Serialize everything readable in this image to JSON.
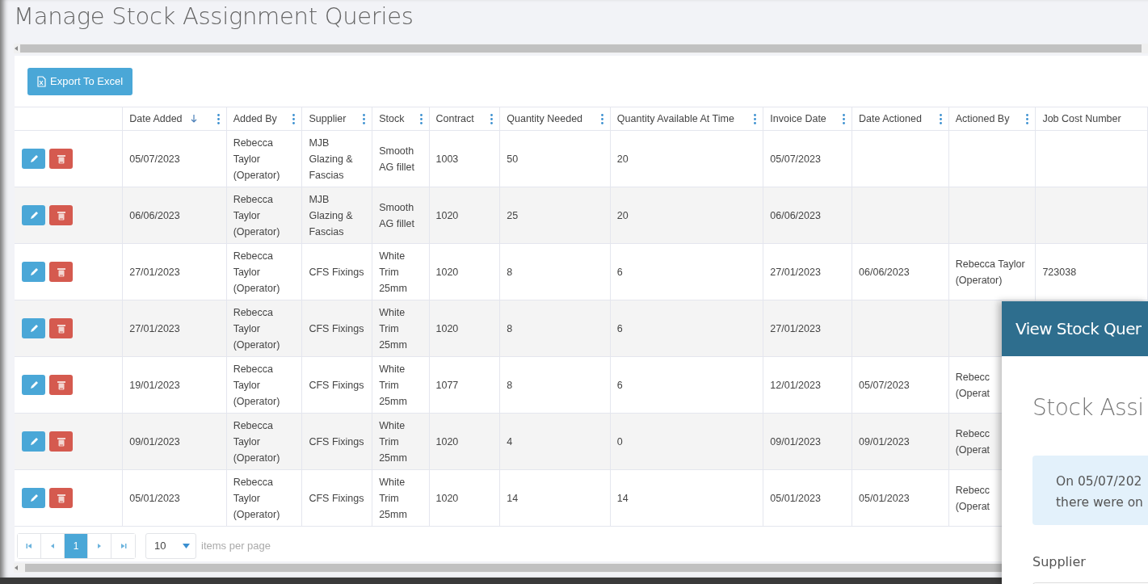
{
  "page": {
    "title": "Manage Stock Assignment Queries"
  },
  "toolbar": {
    "export_button": "Export To Excel"
  },
  "table": {
    "columns": [
      {
        "label": "Date Added",
        "menu": true,
        "sorted": true
      },
      {
        "label": "Added By",
        "menu": true,
        "sorted": false
      },
      {
        "label": "Supplier",
        "menu": true,
        "sorted": false
      },
      {
        "label": "Stock",
        "menu": true,
        "sorted": false
      },
      {
        "label": "Contract",
        "menu": true,
        "sorted": false
      },
      {
        "label": "Quantity Needed",
        "menu": true,
        "sorted": false
      },
      {
        "label": "Quantity Available At Time",
        "menu": true,
        "sorted": false
      },
      {
        "label": "Invoice Date",
        "menu": true,
        "sorted": false
      },
      {
        "label": "Date Actioned",
        "menu": true,
        "sorted": false
      },
      {
        "label": "Actioned By",
        "menu": true,
        "sorted": false
      },
      {
        "label": "Job Cost Number",
        "menu": false,
        "sorted": false
      }
    ],
    "rows": [
      {
        "cells": [
          "05/07/2023",
          "Rebecca Taylor (Operator)",
          "MJB Glazing & Fascias",
          "Smooth AG fillet",
          "1003",
          "50",
          "20",
          "05/07/2023",
          "",
          "",
          ""
        ]
      },
      {
        "cells": [
          "06/06/2023",
          "Rebecca Taylor (Operator)",
          "MJB Glazing & Fascias",
          "Smooth AG fillet",
          "1020",
          "25",
          "20",
          "06/06/2023",
          "",
          "",
          ""
        ]
      },
      {
        "cells": [
          "27/01/2023",
          "Rebecca Taylor (Operator)",
          "CFS Fixings",
          "White Trim 25mm",
          "1020",
          "8",
          "6",
          "27/01/2023",
          "06/06/2023",
          "Rebecca Taylor (Operator)",
          "723038"
        ]
      },
      {
        "cells": [
          "27/01/2023",
          "Rebecca Taylor (Operator)",
          "CFS Fixings",
          "White Trim 25mm",
          "1020",
          "8",
          "6",
          "27/01/2023",
          "",
          "",
          ""
        ]
      },
      {
        "cells": [
          "19/01/2023",
          "Rebecca Taylor (Operator)",
          "CFS Fixings",
          "White Trim 25mm",
          "1077",
          "8",
          "6",
          "12/01/2023",
          "05/07/2023",
          "Rebecc\n(Operat",
          ""
        ]
      },
      {
        "cells": [
          "09/01/2023",
          "Rebecca Taylor (Operator)",
          "CFS Fixings",
          "White Trim 25mm",
          "1020",
          "4",
          "0",
          "09/01/2023",
          "09/01/2023",
          "Rebecc\n(Operat",
          ""
        ]
      },
      {
        "cells": [
          "05/01/2023",
          "Rebecca Taylor (Operator)",
          "CFS Fixings",
          "White Trim 25mm",
          "1020",
          "14",
          "14",
          "05/01/2023",
          "05/01/2023",
          "Rebecc\n(Operat",
          ""
        ]
      }
    ]
  },
  "pager": {
    "pages": [
      {
        "label": "1",
        "selected": true
      }
    ],
    "page_size": "10",
    "page_size_label": "items per page"
  },
  "modal": {
    "title": "View Stock Quer",
    "heading": "Stock Assi",
    "info_lines": [
      "On 05/07/202",
      "there were on"
    ],
    "field_label": "Supplier"
  }
}
